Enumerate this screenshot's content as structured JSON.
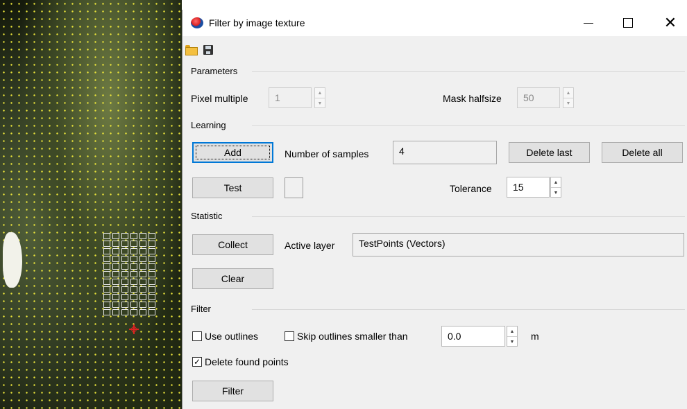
{
  "window": {
    "title": "Filter by image texture",
    "close_glyph": "✕"
  },
  "toolbar": {
    "open_icon": "folder-open-icon",
    "save_icon": "floppy-save-icon"
  },
  "parameters": {
    "section_label": "Parameters",
    "pixel_multiple_label": "Pixel multiple",
    "pixel_multiple_value": "1",
    "mask_halfsize_label": "Mask halfsize",
    "mask_halfsize_value": "50"
  },
  "learning": {
    "section_label": "Learning",
    "add_label": "Add",
    "number_of_samples_label": "Number of samples",
    "number_of_samples_value": "4",
    "delete_last_label": "Delete last",
    "delete_all_label": "Delete all",
    "test_label": "Test",
    "tolerance_label": "Tolerance",
    "tolerance_value": "15"
  },
  "statistic": {
    "section_label": "Statistic",
    "collect_label": "Collect",
    "active_layer_label": "Active layer",
    "active_layer_value": "TestPoints (Vectors)",
    "clear_label": "Clear"
  },
  "filter": {
    "section_label": "Filter",
    "use_outlines_label": "Use outlines",
    "use_outlines_checked": false,
    "skip_outlines_label": "Skip outlines smaller than",
    "skip_outlines_checked": false,
    "skip_value": "0.0",
    "unit_label": "m",
    "delete_found_points_label": "Delete found points",
    "delete_found_points_checked": true,
    "filter_button_label": "Filter"
  },
  "colors": {
    "focus_border": "#0078d7",
    "dialog_bg": "#f0f0f0",
    "map_dot": "#e8e23a",
    "target": "#dd2222"
  }
}
